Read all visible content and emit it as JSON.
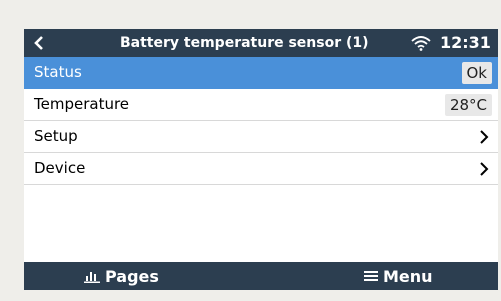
{
  "header": {
    "title": "Battery temperature sensor (1)",
    "time": "12:31",
    "back_icon": "chevron-left-icon",
    "wifi_icon": "wifi-icon"
  },
  "rows": [
    {
      "label": "Status",
      "value": "Ok",
      "selected": true
    },
    {
      "label": "Temperature",
      "value": "28°C"
    },
    {
      "label": "Setup",
      "submenu": true
    },
    {
      "label": "Device",
      "submenu": true
    }
  ],
  "footer": {
    "pages_label": "Pages",
    "menu_label": "Menu",
    "pages_icon": "bar-chart-icon",
    "menu_icon": "hamburger-icon"
  },
  "colors": {
    "header_bg": "#2c3e50",
    "selected_row": "#4a90d9",
    "value_bg": "#e8e8e8"
  }
}
